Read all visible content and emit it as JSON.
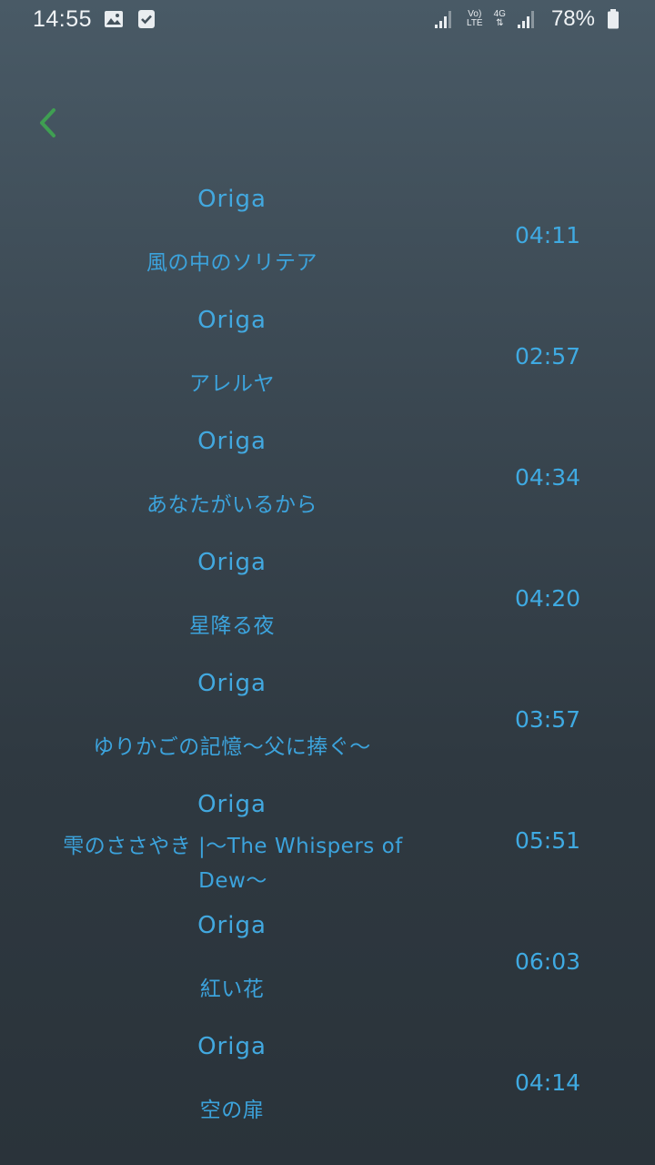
{
  "status_bar": {
    "time": "14:55",
    "left_icons": [
      "image-icon",
      "checkbox-icon"
    ],
    "volte_label_top": "Vo)",
    "volte_label_bottom": "LTE",
    "network_label": "4G",
    "battery": "78%"
  },
  "nav": {
    "back_icon": "chevron-left-icon",
    "accent_color": "#3f9f52"
  },
  "tracks": [
    {
      "artist": "Origa",
      "title": "風の中のソリテア",
      "duration": "04:11"
    },
    {
      "artist": "Origa",
      "title": "アレルヤ",
      "duration": "02:57"
    },
    {
      "artist": "Origa",
      "title": "あなたがいるから",
      "duration": "04:34"
    },
    {
      "artist": "Origa",
      "title": "星降る夜",
      "duration": "04:20"
    },
    {
      "artist": "Origa",
      "title": "ゆりかごの記憶〜父に捧ぐ〜",
      "duration": "03:57"
    },
    {
      "artist": "Origa",
      "title": "雫のささやき |〜The Whispers of Dew〜",
      "duration": "05:51"
    },
    {
      "artist": "Origa",
      "title": "紅い花",
      "duration": "06:03"
    },
    {
      "artist": "Origa",
      "title": "空の扉",
      "duration": "04:14"
    }
  ],
  "colors": {
    "text_accent": "#3ca3dc",
    "background_top": "#495a66",
    "background_bottom": "#2a333a"
  }
}
